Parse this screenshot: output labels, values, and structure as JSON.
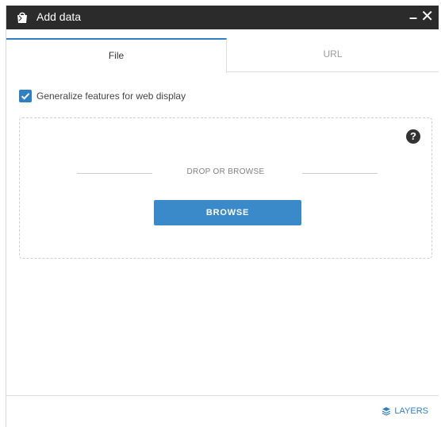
{
  "window": {
    "title": "Add data",
    "title_icon": "bag-icon",
    "minimize_label": "–",
    "close_label": "✕"
  },
  "tabs": [
    {
      "label": "File",
      "active": true
    },
    {
      "label": "URL",
      "active": false
    }
  ],
  "options": {
    "generalize_label": "Generalize features for web display",
    "generalize_checked": true
  },
  "dropzone": {
    "help_label": "?",
    "drop_text": "DROP OR BROWSE",
    "browse_label": "BROWSE"
  },
  "footer": {
    "layers_label": "LAYERS",
    "layers_icon": "layers-icon"
  },
  "colors": {
    "titlebar": "#2b2b2b",
    "accent": "#2f7fc3",
    "button": "#3a89c9"
  }
}
